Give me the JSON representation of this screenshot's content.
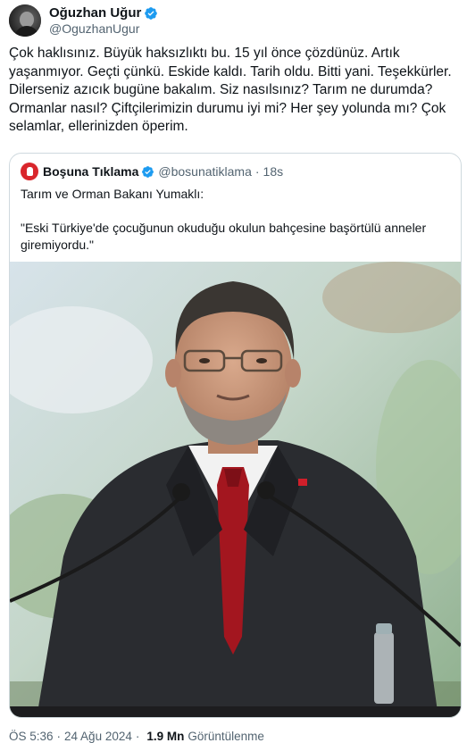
{
  "author": {
    "display_name": "Oğuzhan Uğur",
    "handle": "@OguzhanUgur"
  },
  "tweet": {
    "text": "Çok haklısınız. Büyük haksızlıktı bu. 15 yıl önce çözdünüz. Artık yaşanmıyor. Geçti çünkü. Eskide kaldı. Tarih oldu. Bitti yani. Teşekkürler. Dilerseniz azıcık bugüne bakalım. Siz nasılsınız? Tarım ne durumda? Ormanlar nasıl? Çiftçilerimizin durumu iyi mi? Her şey yolunda mı? Çok selamlar, ellerinizden öperim."
  },
  "quote": {
    "display_name": "Boşuna Tıklama",
    "handle": "@bosunatiklama",
    "separator": "·",
    "time": "18s",
    "line1": "Tarım ve Orman Bakanı Yumaklı:",
    "line2": "\"Eski Türkiye'de çocuğunun okuduğu okulun bahçesine başörtülü anneler giremiyordu.\""
  },
  "footer": {
    "time": "ÖS 5:36",
    "separator": "·",
    "date": "24 Ağu 2024",
    "separator2": "·",
    "views_count": "1.9 Mn",
    "views_label": "Görüntülenme"
  },
  "colors": {
    "verified": "#1d9bf0",
    "text": "#0f1419",
    "secondary": "#536471",
    "border": "#cfd9de",
    "quote_avatar": "#d9262c",
    "tie": "#a3161f"
  },
  "icons": {
    "verified": "verified-badge-icon",
    "quote_avatar": "hand-stop-icon"
  }
}
